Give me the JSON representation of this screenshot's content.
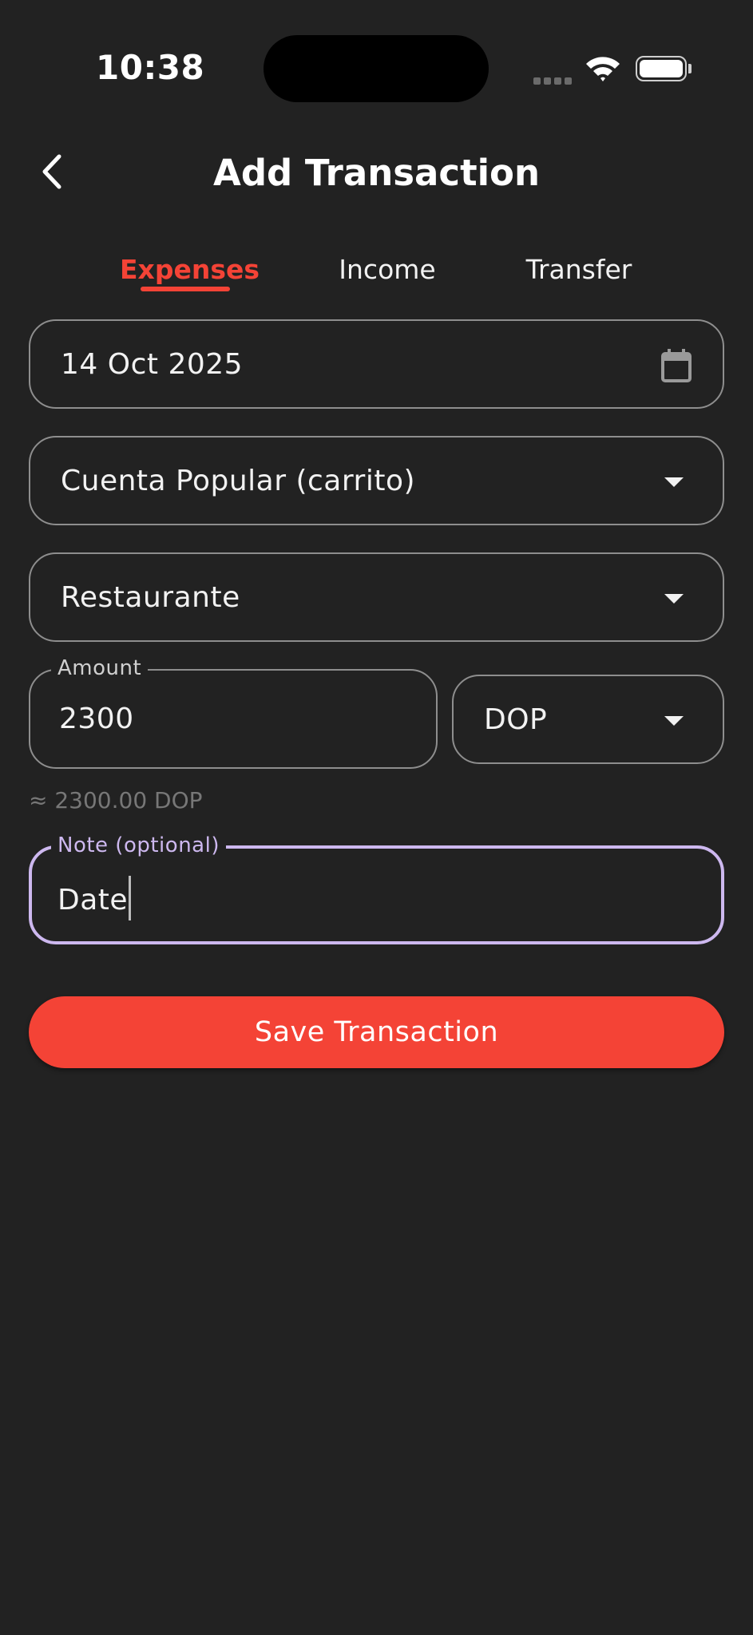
{
  "status_bar": {
    "time": "10:38"
  },
  "header": {
    "title": "Add Transaction",
    "back_icon": "chevron-left-icon"
  },
  "tabs": [
    {
      "label": "Expenses",
      "active": true
    },
    {
      "label": "Income",
      "active": false
    },
    {
      "label": "Transfer",
      "active": false
    }
  ],
  "form": {
    "date": {
      "value": "14 Oct 2025",
      "icon": "calendar-icon"
    },
    "account": {
      "value": "Cuenta Popular (carrito)"
    },
    "category": {
      "value": "Restaurante"
    },
    "amount": {
      "label": "Amount",
      "value": "2300"
    },
    "currency": {
      "value": "DOP"
    },
    "converted_hint": "≈ 2300.00 DOP",
    "note": {
      "label": "Note (optional)",
      "value": "Date"
    }
  },
  "actions": {
    "save_label": "Save Transaction"
  },
  "colors": {
    "accent": "#f44336",
    "focus": "#cdb8ef",
    "background": "#222222"
  }
}
